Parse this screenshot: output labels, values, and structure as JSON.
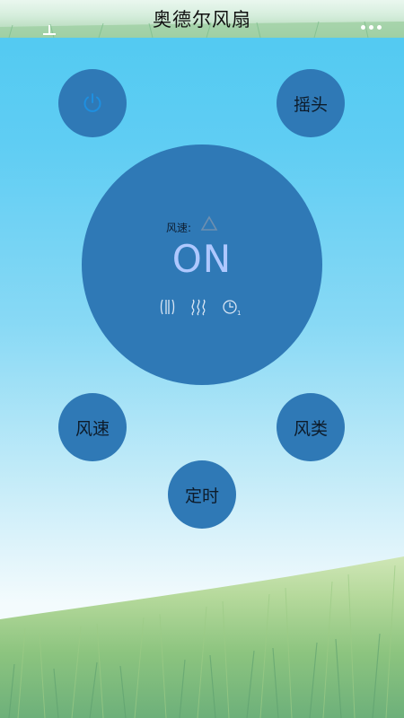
{
  "app": {
    "title": "奥德尔风扇"
  },
  "controls": {
    "power_icon": "power-icon",
    "swing_label": "摇头",
    "speed_label": "风速",
    "mode_label": "风类",
    "timer_label": "定时"
  },
  "dial": {
    "speed_caption": "风速:",
    "speed_indicator_icon": "triangle-outline-icon",
    "state": "ON",
    "status_icons": [
      "wind-bars-icon",
      "wind-waves-icon",
      "timer-icon"
    ],
    "timer_subscript": "1"
  },
  "colors": {
    "button_fill": "#2f79b6",
    "power_icon": "#1e8fe0",
    "state_text": "#aec8ff",
    "status_icon": "#d9e6f5"
  }
}
